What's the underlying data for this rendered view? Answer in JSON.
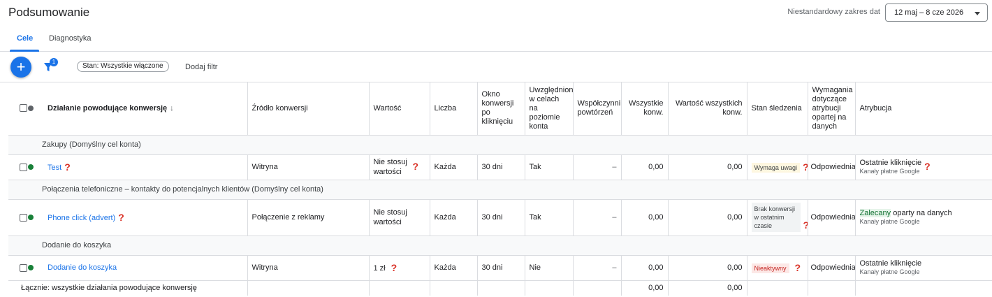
{
  "header": {
    "title": "Podsumowanie",
    "date_label": "Niestandardowy zakres dat",
    "date_range": "12 maj – 8 cze 2026"
  },
  "tabs": [
    {
      "label": "Cele",
      "active": true
    },
    {
      "label": "Diagnostyka",
      "active": false
    }
  ],
  "toolbar": {
    "add_label": "+",
    "filter_count": "1",
    "filter_chip": "Stan: Wszystkie włączone",
    "add_filter": "Dodaj filtr"
  },
  "columns": {
    "action": "Działanie powodujące konwersję",
    "sort_arrow": "↓",
    "source": "Źródło konwersji",
    "value": "Wartość",
    "count": "Liczba",
    "window": "Okno konwersji po kliknięciu",
    "included": "Uwzględniono w celach na poziomie konta",
    "repeat": "Współczynnik powtórzeń",
    "all_conv": "Wszystkie konw.",
    "all_conv_value": "Wartość wszystkich konw.",
    "tracking": "Stan śledzenia",
    "data_req": "Wymagania dotyczące atrybucji opartej na danych",
    "attribution": "Atrybucja"
  },
  "groups": [
    {
      "label": "Zakupy (Domyślny cel konta)",
      "rows": [
        {
          "name": "Test",
          "source": "Witryna",
          "value": "Nie stosuj wartości",
          "count": "Każda",
          "window": "30 dni",
          "included": "Tak",
          "repeat": "–",
          "all_conv": "0,00",
          "all_conv_value": "0,00",
          "tracking": "Wymaga uwagi",
          "data_req": "Odpowiednia",
          "attribution": "Ostatnie kliknięcie",
          "attribution_sub": "Kanały płatne Google"
        }
      ]
    },
    {
      "label": "Połączenia telefoniczne – kontakty do potencjalnych klientów (Domyślny cel konta)",
      "rows": [
        {
          "name": "Phone click (advert)",
          "source": "Połączenie z reklamy",
          "value": "Nie stosuj wartości",
          "count": "Każda",
          "window": "30 dni",
          "included": "Tak",
          "repeat": "–",
          "all_conv": "0,00",
          "all_conv_value": "0,00",
          "tracking": "Brak konwersji w ostatnim czasie",
          "data_req": "Odpowiednia",
          "attribution_hl": "Zalecany",
          "attribution": "oparty na danych",
          "attribution_sub": "Kanały płatne Google"
        }
      ]
    },
    {
      "label": "Dodanie do koszyka",
      "rows": [
        {
          "name": "Dodanie do koszyka",
          "source": "Witryna",
          "value": "1 zł",
          "count": "Każda",
          "window": "30 dni",
          "included": "Nie",
          "repeat": "–",
          "all_conv": "0,00",
          "all_conv_value": "0,00",
          "tracking": "Nieaktywny",
          "data_req": "Odpowiednia",
          "attribution": "Ostatnie kliknięcie",
          "attribution_sub": "Kanały płatne Google"
        }
      ]
    }
  ],
  "total": {
    "label": "Łącznie: wszystkie działania powodujące konwersję",
    "all_conv": "0,00",
    "all_conv_value": "0,00"
  },
  "help_glyph": "?",
  "colors": {
    "accent": "#1a73e8",
    "status_active": "#188038",
    "help": "#d93025"
  }
}
